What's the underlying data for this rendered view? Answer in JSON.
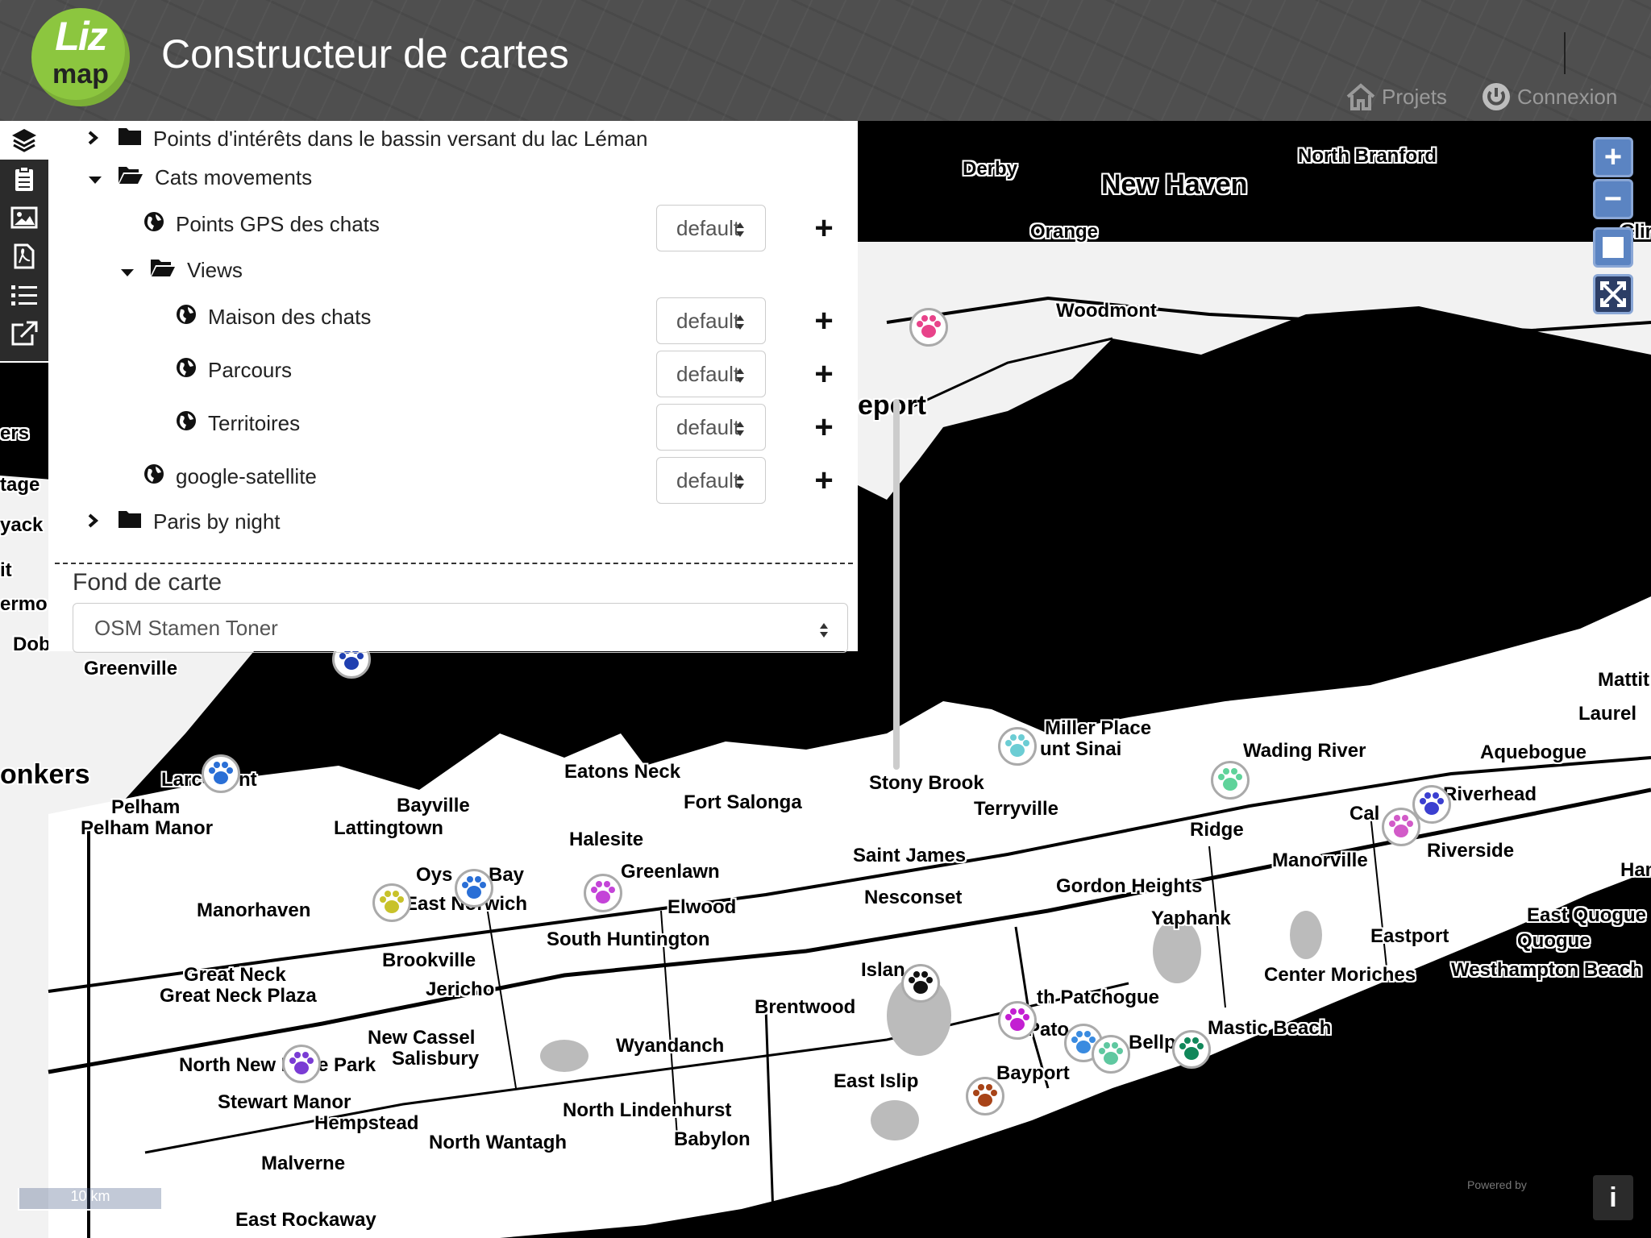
{
  "header": {
    "logo_top": "Liz",
    "logo_bottom": "map",
    "title": "Constructeur de cartes",
    "nav": {
      "projects": "Projets",
      "login": "Connexion"
    }
  },
  "toolbar": {
    "items": [
      "layers-icon",
      "clipboard-icon",
      "image-icon",
      "pdf-icon",
      "list-icon",
      "external-link-icon"
    ]
  },
  "layers": {
    "tree": [
      {
        "label": "Points d'intérêts dans le bassin versant du lac Léman",
        "type": "group",
        "expanded": false
      },
      {
        "label": "Cats movements",
        "type": "group",
        "expanded": true
      },
      {
        "label": "Points GPS des chats",
        "type": "layer",
        "style": "default"
      },
      {
        "label": "Views",
        "type": "group",
        "expanded": true
      },
      {
        "label": "Maison des chats",
        "type": "layer",
        "style": "default"
      },
      {
        "label": "Parcours",
        "type": "layer",
        "style": "default"
      },
      {
        "label": "Territoires",
        "type": "layer",
        "style": "default"
      },
      {
        "label": "google-satellite",
        "type": "layer",
        "style": "default"
      },
      {
        "label": "Paris by night",
        "type": "group",
        "expanded": false
      }
    ],
    "add_symbol": "+"
  },
  "basemap": {
    "title": "Fond de carte",
    "selected": "OSM Stamen Toner"
  },
  "zoom": {
    "in": "+",
    "out": "−"
  },
  "scale": "10 km",
  "attribution": "Powered by",
  "info": "i",
  "places": [
    "New Haven",
    "North Branford",
    "Derby",
    "Orange",
    "Woodmont",
    "eport",
    "Miller Place",
    "unt Sinai",
    "Wading River",
    "Aquebogue",
    "Riverhead",
    "Mattit",
    "Laurel",
    "Stony Brook",
    "Terryville",
    "Ridge",
    "Cal",
    "Riverside",
    "Manorville",
    "Hamp",
    "Saint James",
    "Nesconset",
    "Gordon Heights",
    "Yaphank",
    "East Quogue",
    "Quogue",
    "Eastport",
    "Westhampton Beach",
    "Center Moriches",
    "Eatons Neck",
    "Fort Salonga",
    "Halesite",
    "Greenlawn",
    "Elwood",
    "Bayville",
    "Lattingtown",
    "Oys",
    "Bay",
    "East Norwich",
    "Manorhaven",
    "South Huntington",
    "Brookville",
    "Jericho",
    "Islan",
    "th Patchogue",
    "Pato",
    "Bellp",
    "Mastic Beach",
    "Brentwood",
    "Great Neck",
    "Great Neck Plaza",
    "New Cassel",
    "Salisbury",
    "Wyandanch",
    "North New Hyde Park",
    "Stewart Manor",
    "Hempstead",
    "East Islip",
    "Bayport",
    "North Lindenhurst",
    "North Wantagh",
    "Babylon",
    "Malverne",
    "East Rockaway",
    "Greenville",
    "Larc",
    "nt",
    "Pelham",
    "Pelham Manor",
    "onkers",
    "ers",
    "tage",
    "yack",
    "it",
    "ermo",
    "Dob",
    "Clin"
  ],
  "markers": [
    {
      "color": "#e8438a"
    },
    {
      "color": "#1f3fb0"
    },
    {
      "color": "#2a6fd6"
    },
    {
      "color": "#2a6fd6"
    },
    {
      "color": "#c8c22a"
    },
    {
      "color": "#c444d8"
    },
    {
      "color": "#6ccdd4"
    },
    {
      "color": "#5fd39a"
    },
    {
      "color": "#d25bc8"
    },
    {
      "color": "#3b3fd0"
    },
    {
      "color": "#111111"
    },
    {
      "color": "#c31fd2"
    },
    {
      "color": "#3a8be0"
    },
    {
      "color": "#5fc8a0"
    },
    {
      "color": "#11875a"
    },
    {
      "color": "#7a3cd4"
    },
    {
      "color": "#a84418"
    }
  ]
}
